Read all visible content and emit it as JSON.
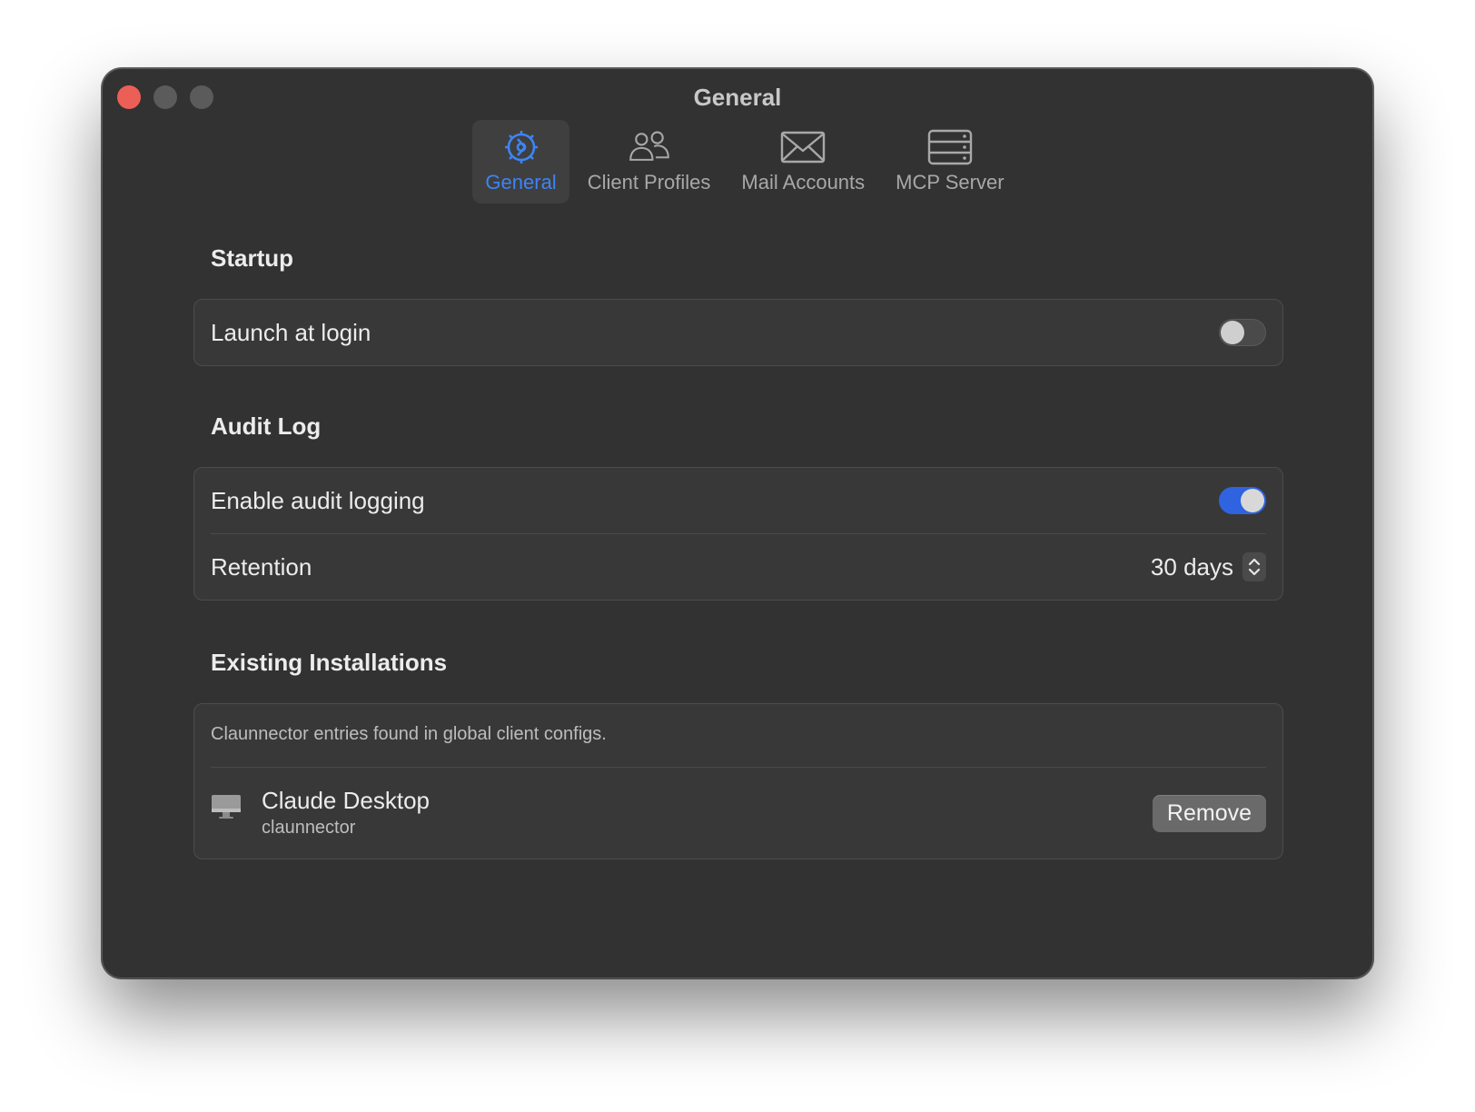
{
  "window": {
    "title": "General"
  },
  "toolbar": {
    "tabs": [
      {
        "label": "General",
        "icon": "gear-icon",
        "active": true
      },
      {
        "label": "Client Profiles",
        "icon": "people-icon",
        "active": false
      },
      {
        "label": "Mail Accounts",
        "icon": "envelope-icon",
        "active": false
      },
      {
        "label": "MCP Server",
        "icon": "server-icon",
        "active": false
      }
    ]
  },
  "startup": {
    "title": "Startup",
    "launch_at_login": {
      "label": "Launch at login",
      "enabled": false
    }
  },
  "audit_log": {
    "title": "Audit Log",
    "enable": {
      "label": "Enable audit logging",
      "enabled": true
    },
    "retention": {
      "label": "Retention",
      "value": "30 days"
    }
  },
  "installations": {
    "title": "Existing Installations",
    "note": "Claunnector entries found in global client configs.",
    "items": [
      {
        "name": "Claude Desktop",
        "sub": "claunnector",
        "icon": "desktop-icon",
        "action": "Remove"
      }
    ]
  },
  "colors": {
    "accent": "#3d84f5",
    "toggle_on": "#2f63e0",
    "close": "#ec5f57"
  }
}
